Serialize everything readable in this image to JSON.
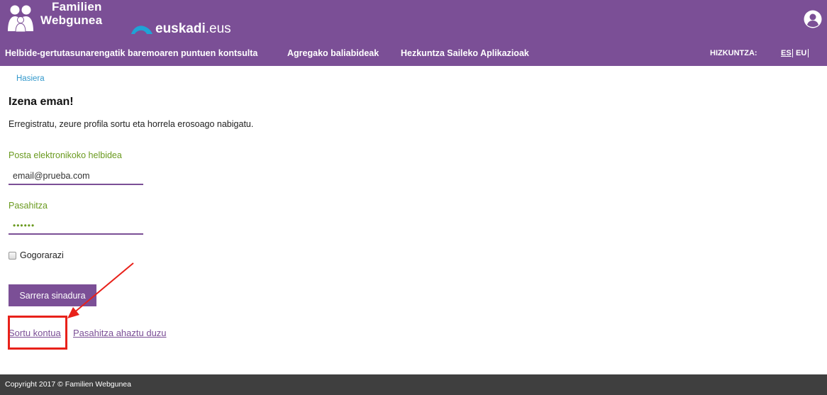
{
  "header": {
    "brand_line1": "Familien",
    "brand_line2": "Webgunea",
    "euskadi_bold": "euskadi",
    "euskadi_rest": ".eus",
    "user_icon": "user-circle-icon",
    "brand_color": "#7b4f96"
  },
  "nav": {
    "items": [
      {
        "label": "Helbide-gertutasunarengatik baremoaren puntuen kontsulta"
      },
      {
        "label": "Agregako baliabideak"
      },
      {
        "label": "Hezkuntza Saileko Aplikazioak"
      }
    ],
    "language_label": "HIZKUNTZA:",
    "lang_es": "ES",
    "lang_eu": "EU"
  },
  "breadcrumb": "Hasiera",
  "main": {
    "title": "Izena eman!",
    "intro": "Erregistratu, zeure profila sortu eta horrela erosoago nabigatu.",
    "email_label": "Posta elektronikoko helbidea",
    "email_value": "email@prueba.com",
    "password_label": "Pasahitza",
    "password_value": "••••••",
    "remember_label": "Gogorarazi",
    "submit_label": "Sarrera sinadura",
    "create_account_link": "Sortu kontua",
    "forgot_password_link": "Pasahitza ahaztu duzu"
  },
  "footer": {
    "copyright": "Copyright 2017 © Familien Webgunea"
  },
  "annotation_color": "#e8211a"
}
